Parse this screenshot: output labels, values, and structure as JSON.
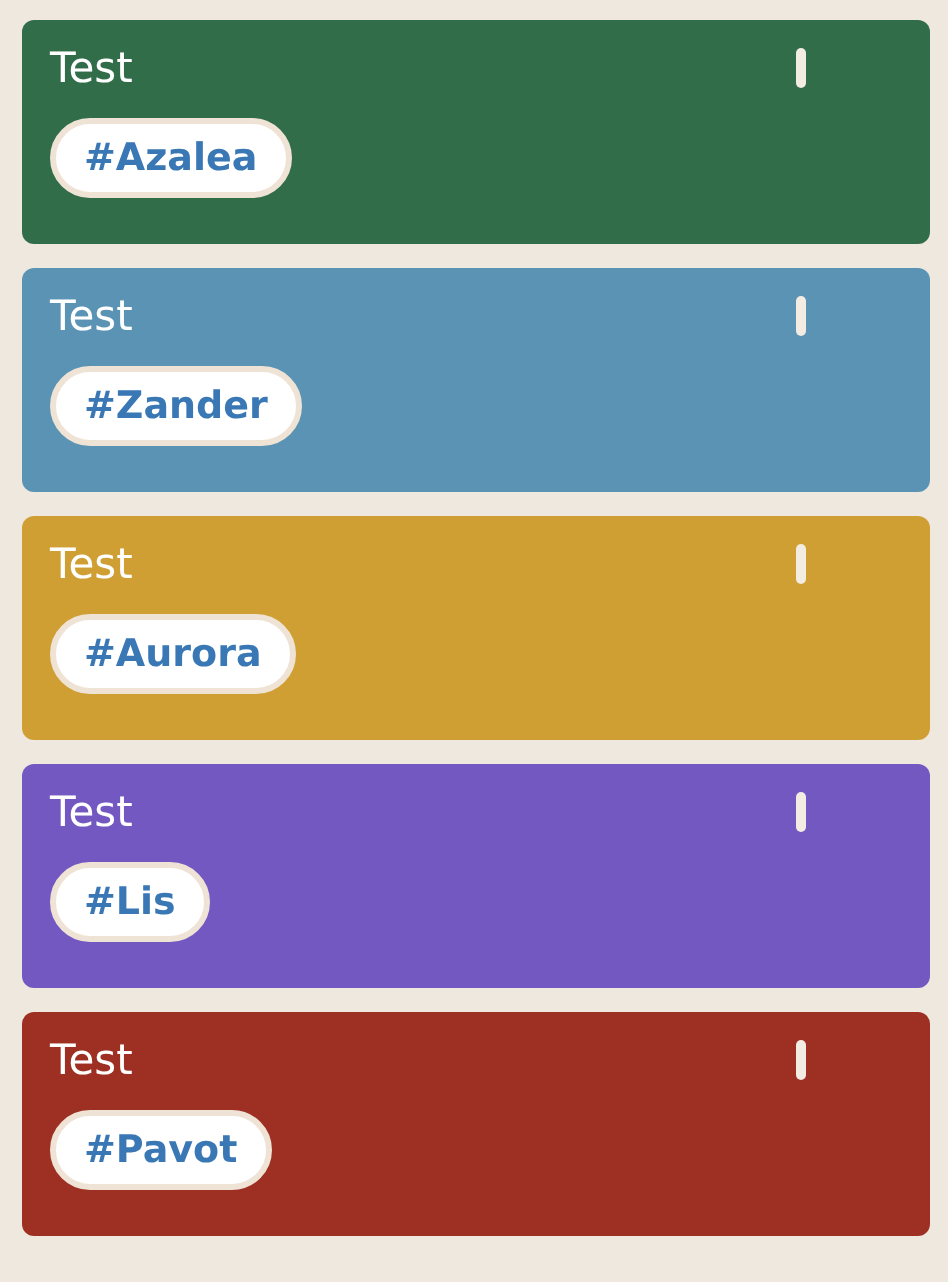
{
  "cards": [
    {
      "title": "Test",
      "tag": "#Azalea",
      "color": "#326d4a"
    },
    {
      "title": "Test",
      "tag": "#Zander",
      "color": "#5b93b4"
    },
    {
      "title": "Test",
      "tag": "#Aurora",
      "color": "#cf9f34"
    },
    {
      "title": "Test",
      "tag": "#Lis",
      "color": "#7358c2"
    },
    {
      "title": "Test",
      "tag": "#Pavot",
      "color": "#9d2f23"
    }
  ]
}
